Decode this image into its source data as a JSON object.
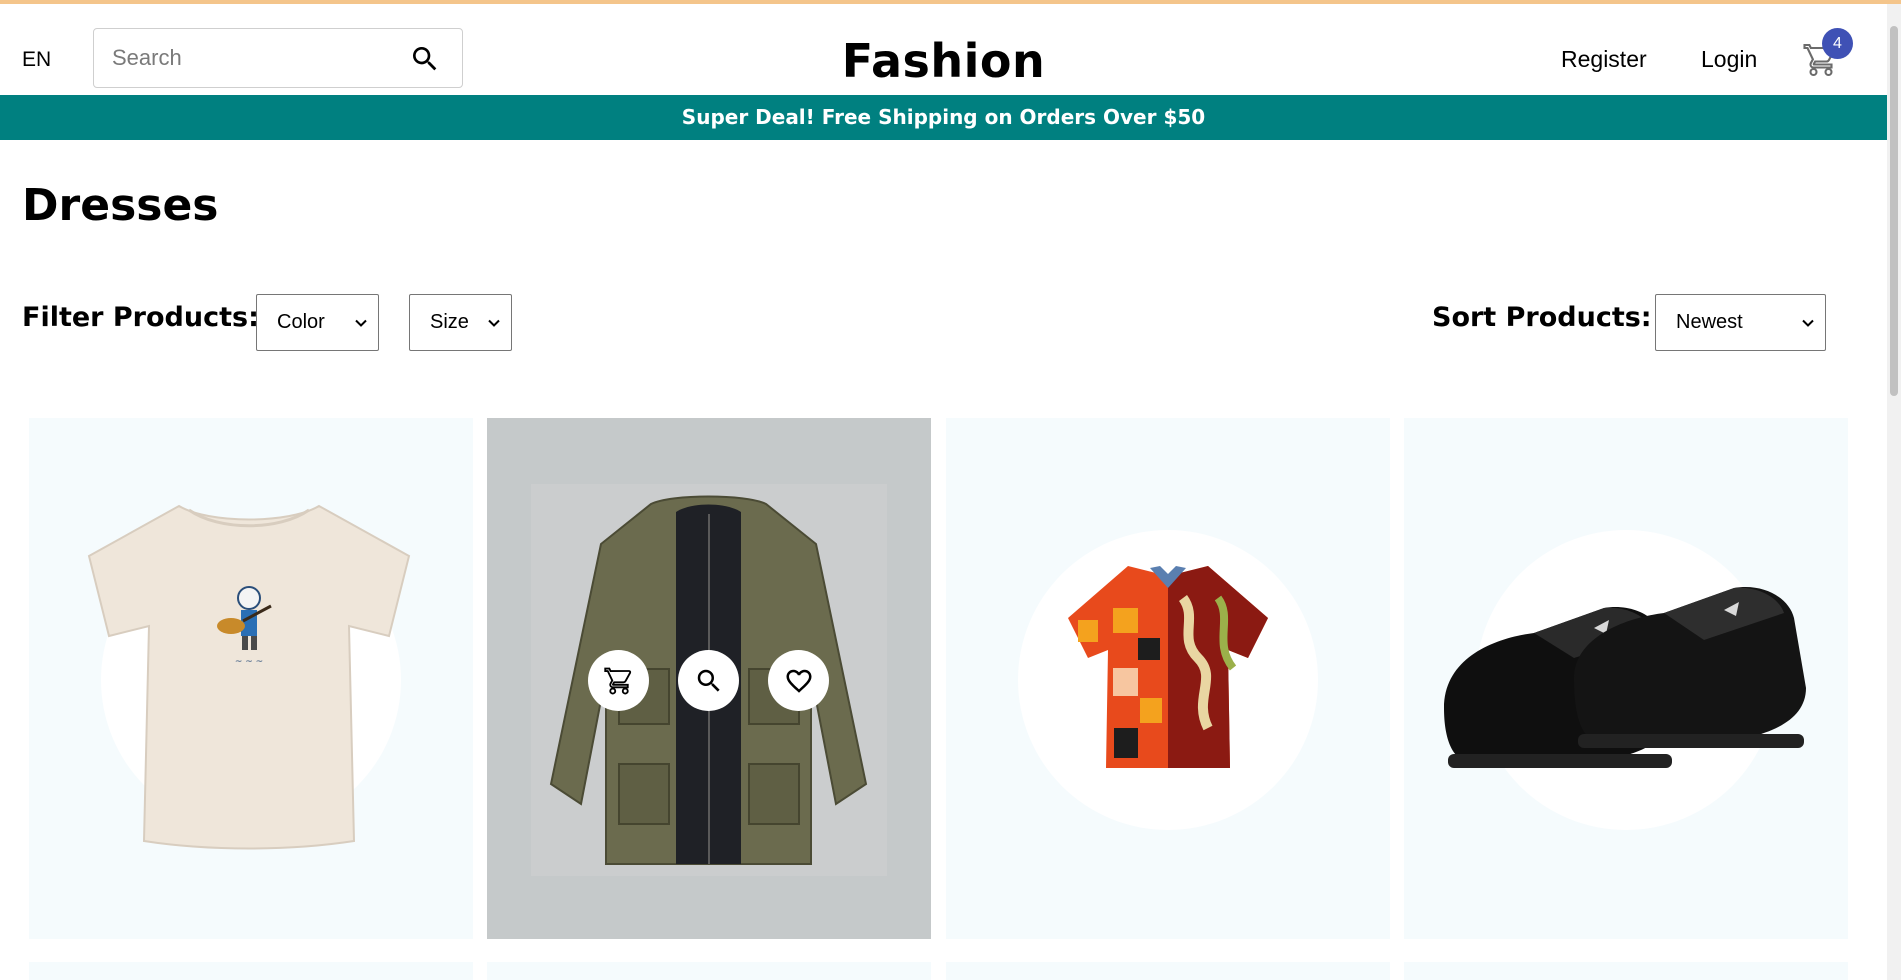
{
  "header": {
    "language": "EN",
    "search_placeholder": "Search",
    "logo": "Fashion",
    "register_label": "Register",
    "login_label": "Login",
    "cart_count": "4"
  },
  "announcement": "Super Deal! Free Shipping on Orders Over $50",
  "page": {
    "title": "Dresses"
  },
  "filters": {
    "filter_label": "Filter Products:",
    "color_value": "Color",
    "size_value": "Size",
    "sort_label": "Sort Products:",
    "sort_value": "Newest"
  },
  "products": [
    {
      "name": "cream-tshirt",
      "hovered": false
    },
    {
      "name": "olive-jacket",
      "hovered": true
    },
    {
      "name": "patterned-shirt",
      "hovered": false
    },
    {
      "name": "black-loafers",
      "hovered": false
    }
  ],
  "colors": {
    "announcement_bg": "#008080",
    "cart_badge": "#3f51b5",
    "product_bg": "#f5fbfd",
    "hover_bg": "#c5c9ca"
  },
  "icons": [
    "search-icon",
    "cart-icon",
    "chevron-down-icon",
    "magnify-icon",
    "heart-icon"
  ]
}
